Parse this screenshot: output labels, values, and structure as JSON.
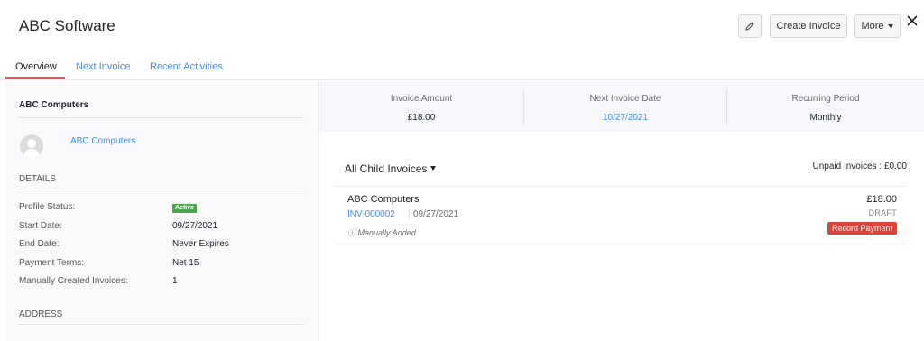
{
  "header": {
    "title": "ABC Software",
    "create_invoice_label": "Create Invoice",
    "more_label": "More"
  },
  "tabs": [
    {
      "label": "Overview",
      "active": true
    },
    {
      "label": "Next Invoice",
      "active": false
    },
    {
      "label": "Recent Activities",
      "active": false
    }
  ],
  "left": {
    "customer_title": "ABC Computers",
    "contact_name": "ABC Computers",
    "details_heading": "DETAILS",
    "details": [
      {
        "label": "Profile Status:",
        "value": "Active"
      },
      {
        "label": "Start Date:",
        "value": "09/27/2021"
      },
      {
        "label": "End Date:",
        "value": "Never Expires"
      },
      {
        "label": "Payment Terms:",
        "value": "Net 15"
      },
      {
        "label": "Manually Created Invoices:",
        "value": "1"
      }
    ],
    "address_heading": "ADDRESS"
  },
  "stats": [
    {
      "label": "Invoice Amount",
      "value": "£18.00"
    },
    {
      "label": "Next Invoice Date",
      "value": "10/27/2021"
    },
    {
      "label": "Recurring Period",
      "value": "Monthly"
    }
  ],
  "child_invoices": {
    "heading": "All Child Invoices",
    "unpaid_label": "Unpaid Invoices : £0.00",
    "rows": [
      {
        "customer": "ABC Computers",
        "number": "INV-000002",
        "date": "09/27/2021",
        "note": "ⓘ Manually Added",
        "amount": "£18.00",
        "status": "DRAFT",
        "action": "Record Payment"
      }
    ]
  },
  "colors": {
    "accent_link": "#408dfb",
    "tab_underline": "#d9534f",
    "active_badge": "#4ba64b",
    "record_payment": "#d9453c"
  },
  "icons": {
    "edit": "pencil-icon",
    "close": "close-icon",
    "avatar": "user-avatar-icon"
  }
}
